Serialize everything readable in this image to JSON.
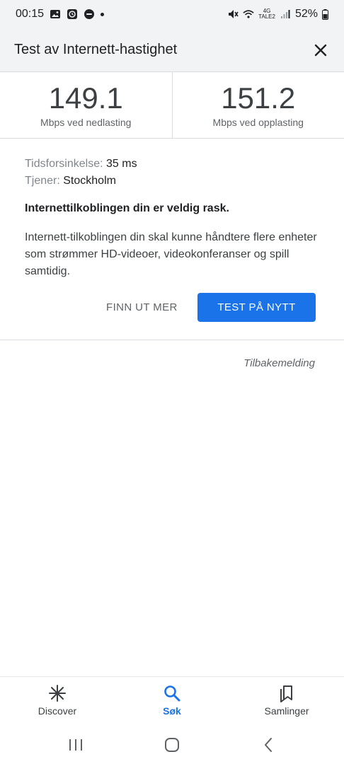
{
  "status_bar": {
    "time": "00:15",
    "battery": "52%",
    "network_top": "4G",
    "network_bottom": "TALE2",
    "left_icons": [
      "image-icon",
      "clock-app-icon",
      "notification-app-icon",
      "dot-icon"
    ],
    "right_icons": [
      "mute-icon",
      "wifi-icon",
      "signal-icon",
      "battery-icon"
    ]
  },
  "header": {
    "title": "Test av Internett-hastighet",
    "close_icon": "close-icon"
  },
  "speeds": {
    "download": {
      "value": "149.1",
      "label": "Mbps ved nedlasting"
    },
    "upload": {
      "value": "151.2",
      "label": "Mbps ved opplasting"
    }
  },
  "details": {
    "latency_label": "Tidsforsinkelse:",
    "latency_value": "35 ms",
    "server_label": "Tjener:",
    "server_value": "Stockholm",
    "headline": "Internettilkoblingen din er veldig rask.",
    "description": "Internett-tilkoblingen din skal kunne håndtere flere enheter som strømmer HD-videoer, videokonferanser og spill samtidig."
  },
  "actions": {
    "learn_more": "FINN UT MER",
    "retest": "TEST PÅ NYTT"
  },
  "feedback": "Tilbakemelding",
  "bottom_nav": {
    "items": [
      {
        "label": "Discover",
        "icon": "asterisk-icon",
        "active": false
      },
      {
        "label": "Søk",
        "icon": "search-icon",
        "active": true
      },
      {
        "label": "Samlinger",
        "icon": "collections-icon",
        "active": false
      }
    ]
  },
  "colors": {
    "accent": "#1a73e8",
    "header_bg": "#f1f3f4",
    "text": "#202124",
    "muted": "#5f6368"
  }
}
